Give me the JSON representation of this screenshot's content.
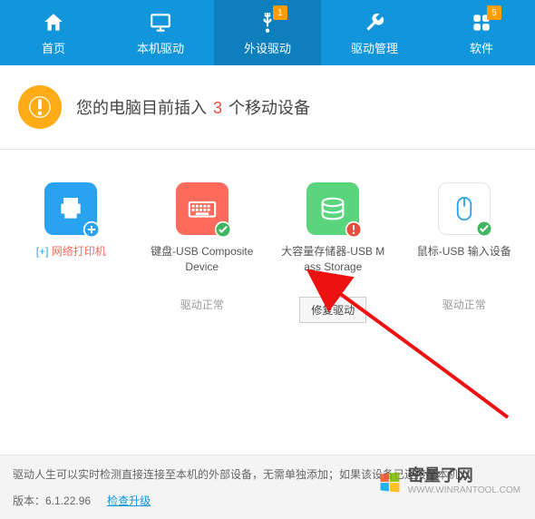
{
  "nav": {
    "items": [
      {
        "label": "首页",
        "icon": "home-icon",
        "badge": null
      },
      {
        "label": "本机驱动",
        "icon": "monitor-icon",
        "badge": null
      },
      {
        "label": "外设驱动",
        "icon": "usb-icon",
        "badge": "1"
      },
      {
        "label": "驱动管理",
        "icon": "wrench-icon",
        "badge": null
      },
      {
        "label": "软件",
        "icon": "apps-icon",
        "badge": "5"
      }
    ],
    "active_index": 2
  },
  "banner": {
    "prefix": "您的电脑目前插入 ",
    "count": "3",
    "suffix": " 个移动设备"
  },
  "devices": [
    {
      "icon": "printer-icon",
      "tile": "blue",
      "badge": "add",
      "name": "网络打印机",
      "bracket": true
    },
    {
      "icon": "keyboard-icon",
      "tile": "orange",
      "badge": "ok",
      "name": "键盘-USB Composite Device"
    },
    {
      "icon": "storage-icon",
      "tile": "green",
      "badge": "warn",
      "name": "大容量存储器-USB Mass Storage"
    },
    {
      "icon": "mouse-icon",
      "tile": "white",
      "badge": "ok",
      "name": "鼠标-USB 输入设备"
    }
  ],
  "status": {
    "normal": "驱动正常",
    "repair": "修复驱动"
  },
  "footer": {
    "tip": "驱动人生可以实时检测直接连接至本机的外部设备，无需单独添加；如果该设备已连接至本机...",
    "version_label": "版本：",
    "version": "6.1.22.96",
    "check_update": "检查升级"
  },
  "watermark": {
    "text": "密量了网",
    "url": "WWW.WINRANTOOL.COM"
  }
}
